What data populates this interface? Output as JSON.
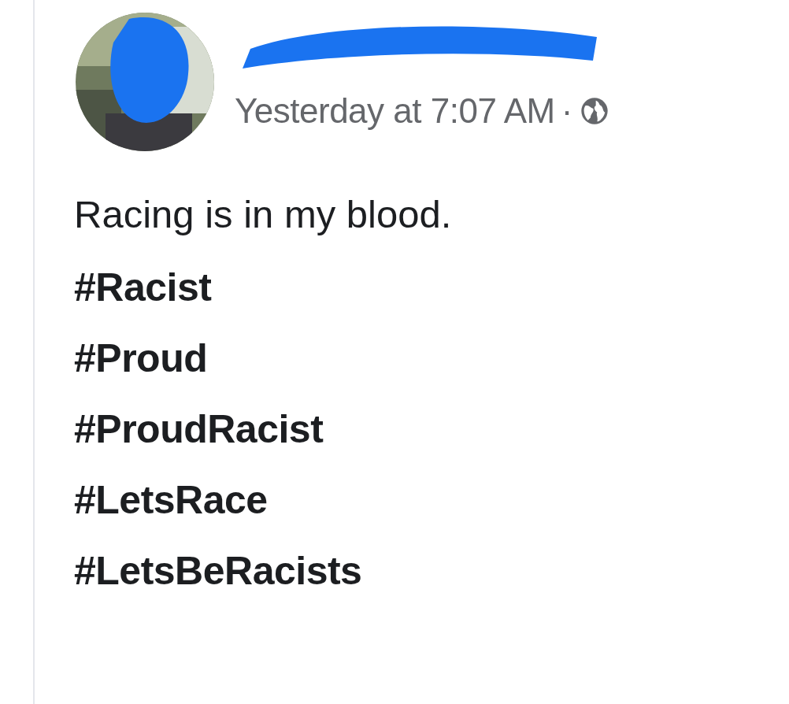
{
  "post": {
    "timestamp": "Yesterday at 7:07 AM",
    "separator": "·",
    "text": "Racing is in my blood.",
    "hashtags": [
      "#Racist",
      "#Proud",
      "#ProudRacist",
      "#LetsRace",
      "#LetsBeRacists"
    ]
  }
}
